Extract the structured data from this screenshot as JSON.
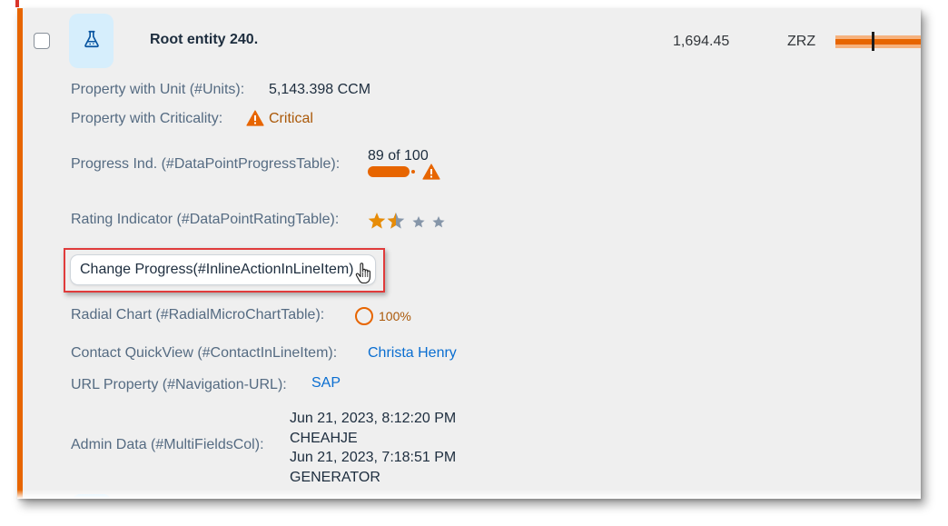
{
  "row": {
    "title": "Root entity 240.",
    "amount": "1,694.45",
    "currency": "ZRZ",
    "avatar_icon": "lab-flask-icon",
    "bullet_chart": {
      "value_fraction": 1.0,
      "target_fraction": 0.43
    }
  },
  "fields": {
    "unit": {
      "label": "Property with Unit (#Units):",
      "value": "5,143.398 CCM"
    },
    "criticality": {
      "label": "Property with Criticality:",
      "value": "Critical",
      "icon": "warning-triangle-icon"
    },
    "progress": {
      "label": "Progress Ind. (#DataPointProgressTable):",
      "value": "89 of 100",
      "percent": 89
    },
    "rating": {
      "label": "Rating Indicator (#DataPointRatingTable):",
      "value": 1.5,
      "max": 4
    },
    "action": {
      "label": "Change Progress(#InlineActionInLineItem)"
    },
    "radial": {
      "label": "Radial Chart (#RadialMicroChartTable):",
      "value": "100%"
    },
    "contact": {
      "label": "Contact QuickView (#ContactInLineItem):",
      "value": "Christa Henry"
    },
    "url": {
      "label": "URL Property (#Navigation-URL):",
      "value": "SAP"
    },
    "admin": {
      "label": "Admin Data (#MultiFieldsCol):",
      "lines": [
        "Jun 21, 2023, 8:12:20 PM",
        "CHEAHJE",
        "Jun 21, 2023, 7:18:51 PM",
        "GENERATOR"
      ]
    }
  },
  "colors": {
    "accent": "#e76500",
    "critical_text": "#aa5808",
    "link": "#0a6ed1",
    "star_filled": "#e78c07",
    "star_empty": "#8696a9",
    "highlight": "#e03b3b"
  }
}
